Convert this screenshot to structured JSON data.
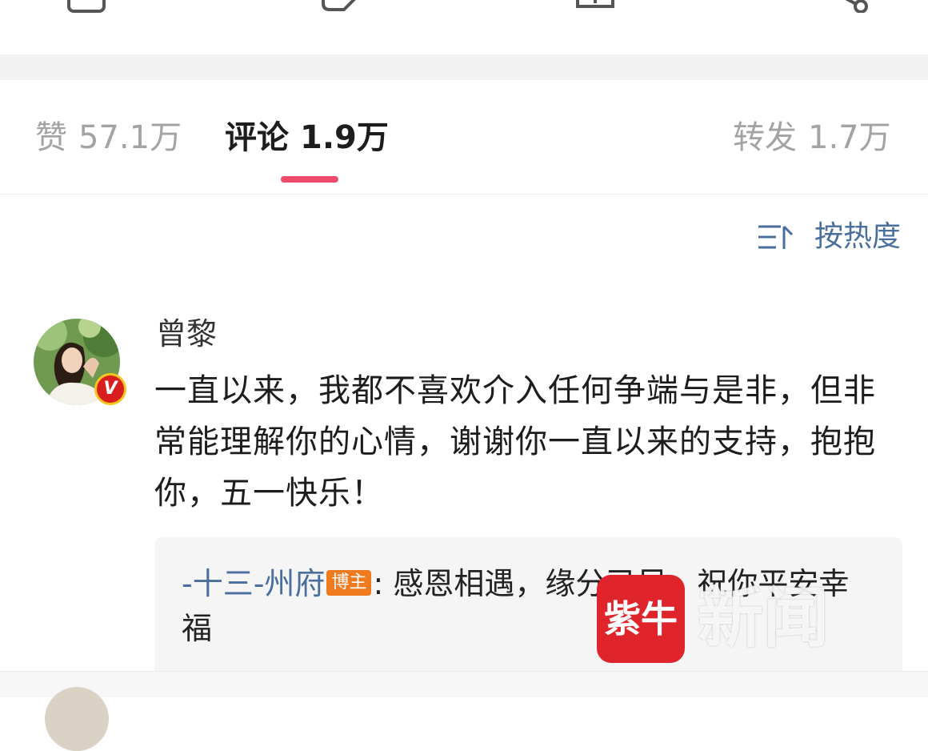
{
  "tabs": {
    "likes": {
      "label": "赞",
      "count": "57.1万"
    },
    "comments": {
      "label": "评论",
      "count": "1.9万"
    },
    "reposts": {
      "label": "转发",
      "count": "1.7万"
    }
  },
  "sort": {
    "label": "按热度",
    "icon": "sort-icon"
  },
  "comment": {
    "username": "曾黎",
    "verified_badge": "V",
    "text": "一直以来，我都不喜欢介入任何争端与是非，但非常能理解你的心情，谢谢你一直以来的支持，抱抱你，五一快乐！",
    "reply": {
      "name": "-十三-州府",
      "badge": "博主",
      "text": ": 感恩相遇，缘分已尽，祝你平安幸福"
    }
  },
  "watermark": {
    "logo_text": "紫牛",
    "text": "新闻"
  },
  "colors": {
    "accent": "#f04a6a",
    "link": "#4a6f9e",
    "owner_badge": "#f07a1e"
  }
}
